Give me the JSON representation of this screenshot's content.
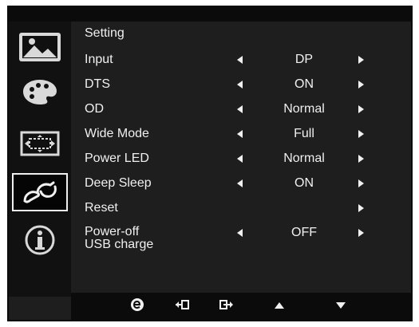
{
  "sidebar": {
    "items": [
      {
        "icon": "picture-icon"
      },
      {
        "icon": "palette-icon"
      },
      {
        "icon": "aspect-ratio-icon"
      },
      {
        "icon": "settings-wrench-icon"
      },
      {
        "icon": "info-icon"
      }
    ],
    "active_index": 3
  },
  "menu": {
    "title": "Setting",
    "rows": [
      {
        "label": "Input",
        "value": "DP",
        "arrows": true
      },
      {
        "label": "DTS",
        "value": "ON",
        "arrows": true
      },
      {
        "label": "OD",
        "value": "Normal",
        "arrows": true
      },
      {
        "label": "Wide Mode",
        "value": "Full",
        "arrows": true
      },
      {
        "label": "Power LED",
        "value": "Normal",
        "arrows": true
      },
      {
        "label": "Deep Sleep",
        "value": "ON",
        "arrows": true
      },
      {
        "label": "Reset",
        "value": "",
        "arrows": "right-only"
      },
      {
        "label": "Power-off\nUSB charge",
        "value": "OFF",
        "arrows": true
      }
    ]
  },
  "footer": {
    "buttons": [
      {
        "icon": "e-key-icon"
      },
      {
        "icon": "exit-icon"
      },
      {
        "icon": "enter-icon"
      },
      {
        "icon": "up-icon"
      },
      {
        "icon": "down-icon"
      }
    ]
  },
  "colors": {
    "text": "#f0f0f0",
    "panel": "#1e1e1e",
    "sidebar": "#111111"
  }
}
